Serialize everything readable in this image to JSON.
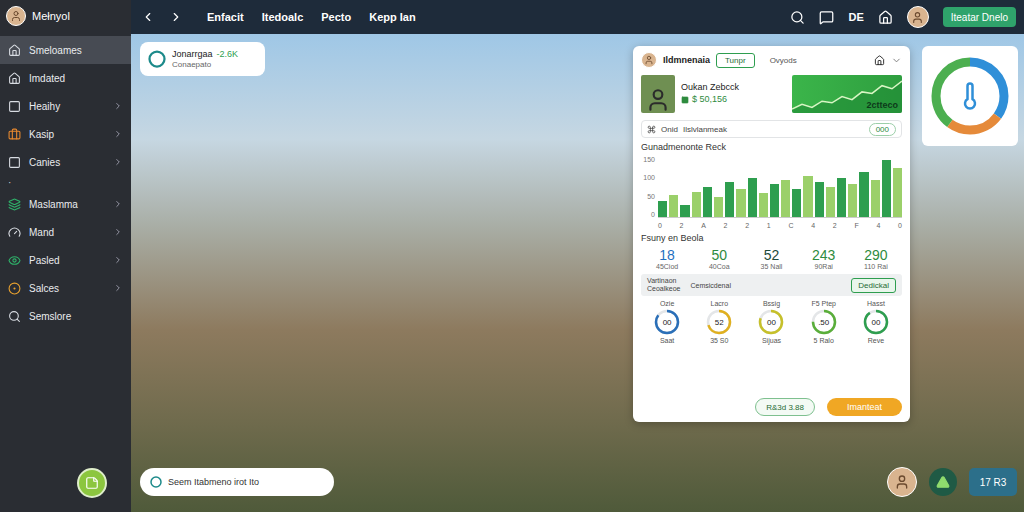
{
  "sidebar": {
    "user": "Mełnyol",
    "items": [
      {
        "kind": "item",
        "label": "Smeloames",
        "selected": true,
        "chevron": false,
        "color": "#d8dce2"
      },
      {
        "kind": "item",
        "label": "Imdated",
        "selected": false,
        "chevron": false,
        "color": "#d8dce2"
      },
      {
        "kind": "item",
        "label": "Heaihy",
        "selected": false,
        "chevron": true,
        "color": "#d8dce2"
      },
      {
        "kind": "item",
        "label": "Kasip",
        "selected": false,
        "chevron": true,
        "color": "#e8892f"
      },
      {
        "kind": "item",
        "label": "Canies",
        "selected": false,
        "chevron": true,
        "color": "#d8dce2"
      },
      {
        "kind": "separator",
        "label": "·",
        "selected": false,
        "chevron": false,
        "color": "#d8dce2"
      },
      {
        "kind": "item",
        "label": "Maslamma",
        "selected": false,
        "chevron": true,
        "color": "#2fb26a"
      },
      {
        "kind": "item",
        "label": "Mand",
        "selected": false,
        "chevron": true,
        "color": "#d8dce2"
      },
      {
        "kind": "item",
        "label": "Pasled",
        "selected": false,
        "chevron": true,
        "color": "#2fb26a"
      },
      {
        "kind": "item",
        "label": "Salces",
        "selected": false,
        "chevron": true,
        "color": "#e8a12f"
      },
      {
        "kind": "item",
        "label": "Semslore",
        "selected": false,
        "chevron": false,
        "color": "#d8dce2"
      }
    ]
  },
  "topbar": {
    "links": [
      "Enfacit",
      "Itedoalc",
      "Pecto",
      "Kepp Ian"
    ],
    "lang": "DE",
    "button": "Iteatar Dnelo"
  },
  "summary_card": {
    "title": "Jonarrgaa",
    "delta": "-2.6K",
    "subtitle": "Conaepato"
  },
  "main_card": {
    "title": "Ildmnenaia",
    "tabs": [
      {
        "label": "Tunpr",
        "selected": true
      },
      {
        "label": "Ovyods",
        "selected": false
      }
    ],
    "profile": {
      "name": "Oukan Zebcck",
      "amount": "$ 50,156",
      "chart": {
        "label": "2ctteco",
        "values": [
          4,
          7,
          5,
          9,
          8,
          12,
          10,
          15,
          14,
          19,
          17,
          22
        ]
      }
    },
    "info": {
      "label": "Onid",
      "detail": "Ilslvlanmeak",
      "badge": "000"
    },
    "chart": {
      "title": "Gunadmenonte Reck",
      "y_ticks": [
        "150",
        "100",
        "50",
        "0"
      ],
      "max": 150,
      "x_labels": [
        "0",
        "2",
        "A",
        "2",
        "2",
        "1",
        "C",
        "4",
        "2",
        "F",
        "4",
        "0"
      ],
      "values": [
        40,
        55,
        30,
        62,
        75,
        50,
        85,
        70,
        95,
        60,
        80,
        92,
        70,
        100,
        85,
        75,
        95,
        80,
        110,
        90,
        140,
        120
      ]
    },
    "stats": {
      "title": "Fsuny en Beola",
      "items": [
        {
          "value": "18",
          "label": "45Ciod",
          "color": "#1f6fc0"
        },
        {
          "value": "50",
          "label": "40Coa",
          "color": "#2e8b3e"
        },
        {
          "value": "52",
          "label": "35 Nall",
          "color": "#1d4a3a"
        },
        {
          "value": "243",
          "label": "90Rai",
          "color": "#2e8b3e"
        },
        {
          "value": "290",
          "label": "110 Rai",
          "color": "#2e8b3e"
        }
      ]
    },
    "subrow": {
      "label": "Vartinaon",
      "sublabel": "Ceoalkeoe",
      "middle": "Cemsicdenal",
      "button": "Dedickal"
    },
    "rings": [
      {
        "label": "Ozie",
        "value": "00",
        "caption": "Saat",
        "level": 0.85,
        "color": "#2a6fb8"
      },
      {
        "label": "Lacro",
        "value": "52",
        "caption": "35 S0",
        "level": 0.7,
        "color": "#e0b020"
      },
      {
        "label": "Bssig",
        "value": "00",
        "caption": "Sijuas",
        "level": 0.8,
        "color": "#c6c02a"
      },
      {
        "label": "F5 Ptep",
        "value": ".50",
        "caption": "5 Ralo",
        "level": 0.75,
        "color": "#5aae3a"
      },
      {
        "label": "Hasst",
        "value": "00",
        "caption": "Reve",
        "level": 0.9,
        "color": "#2e9e4f"
      }
    ],
    "buttons": {
      "secondary": "R&3d 3.88",
      "primary": "Imanteat"
    }
  },
  "gauge": {
    "segments": [
      {
        "value": 35,
        "color": "#2f8fd8"
      },
      {
        "value": 25,
        "color": "#e58a3a"
      },
      {
        "value": 40,
        "color": "#4caf50"
      }
    ]
  },
  "search": {
    "placeholder": "Seem Itabmeno irot Ito"
  },
  "badge": {
    "label": "17 R3"
  }
}
